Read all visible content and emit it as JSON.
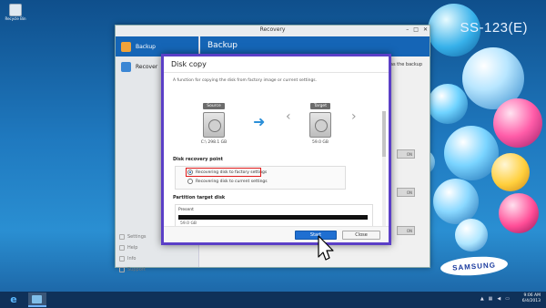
{
  "desktop": {
    "icon_label": "Recycle Bin",
    "model_tag": "SS-123(E)",
    "brand_logo": "SAMSUNG"
  },
  "recovery_window": {
    "title": "Recovery",
    "controls": [
      "–",
      "□",
      "✕"
    ],
    "sidebar": {
      "items": [
        {
          "label": "Backup",
          "active": true
        },
        {
          "label": "Recover",
          "active": false
        }
      ],
      "bottom_links": [
        "Settings",
        "Help",
        "Info",
        "Support"
      ]
    },
    "header": "Backup",
    "backup_tab_label": "as the backup",
    "toggle_labels": [
      "ON",
      "ON",
      "ON"
    ]
  },
  "dialog": {
    "title": "Disk copy",
    "description": "A function for copying the disk from factory image or current settings.",
    "source": {
      "tag": "Source",
      "caption": "C:\\ 298.1 GB"
    },
    "target": {
      "tag": "Target",
      "caption": "59.0 GB"
    },
    "recovery_point": {
      "title": "Disk recovery point",
      "options": [
        {
          "label": "Recovering disk to factory settings",
          "selected": true
        },
        {
          "label": "Recovering disk to current settings",
          "selected": false
        }
      ]
    },
    "partition": {
      "title": "Partition target disk",
      "label": "Present",
      "size": "59.0 GB"
    },
    "buttons": {
      "start": "Start",
      "close": "Close"
    }
  },
  "taskbar": {
    "clock_time": "9:06 AM",
    "clock_date": "6/4/2013"
  }
}
